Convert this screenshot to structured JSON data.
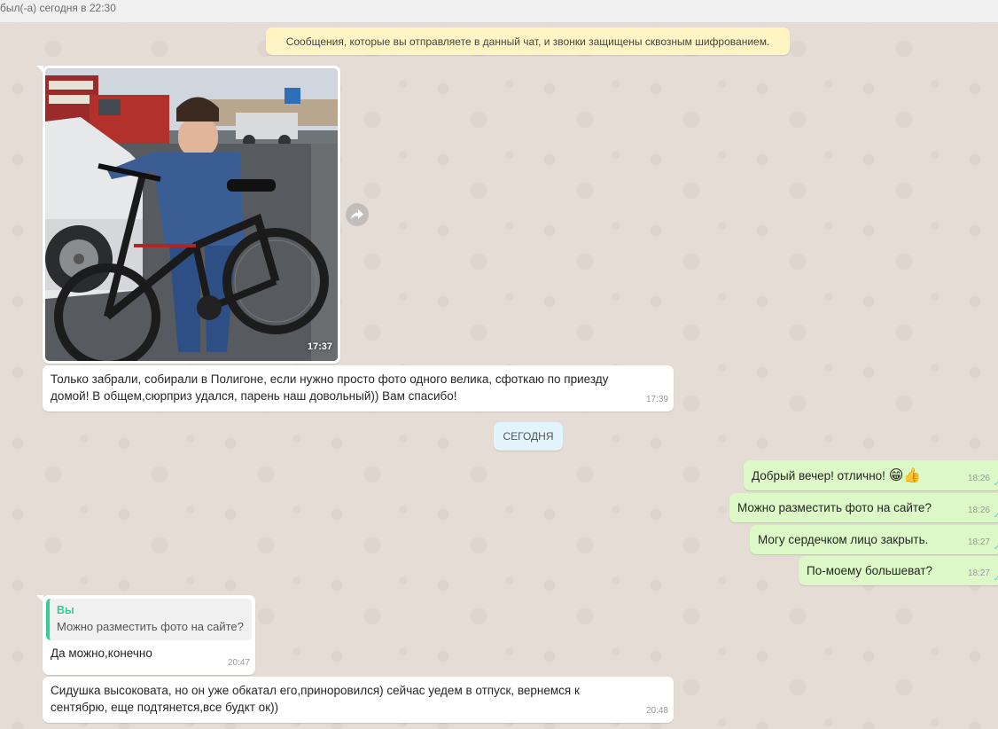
{
  "header": {
    "status": "был(-а) сегодня в 22:30"
  },
  "encryption_notice": "Сообщения, которые вы отправляете в данный чат, и звонки защищены сквозным шифрованием.",
  "messages": {
    "photo": {
      "time": "17:37"
    },
    "m1": {
      "text": "Только забрали, собирали в Полигоне, если нужно просто фото одного велика, сфоткаю по приезду домой! В общем,сюрприз удался, парень наш довольный)) Вам спасибо!",
      "time": "17:39"
    },
    "date_divider": "СЕГОДНЯ",
    "o1": {
      "text": "Добрый вечер! отлично!",
      "emoji": "😁👍",
      "time": "18:26"
    },
    "o2": {
      "text": "Можно разместить фото на сайте?",
      "time": "18:26"
    },
    "o3": {
      "text": "Могу сердечком лицо закрыть.",
      "time": "18:27"
    },
    "o4": {
      "text": "По-моему большеват?",
      "time": "18:27"
    },
    "m2": {
      "quote_author": "Вы",
      "quote_text": "Можно разместить фото на сайте?",
      "text": "Да можно,конечно",
      "time": "20:47"
    },
    "m3": {
      "text": "Сидушка высоковата, но он уже обкатал его,приноровился) сейчас уедем в отпуск, вернемся к сентябрю, еще подтянется,все будкт ок))",
      "time": "20:48"
    }
  },
  "colors": {
    "chat_background": "#e5ddd5",
    "incoming_bubble": "#ffffff",
    "outgoing_bubble": "#dcf8c6",
    "encryption_notice": "#fff5c4",
    "date_pill": "#e1f3fb",
    "quote_accent": "#35cd96",
    "read_ticks": "#4fc3f7"
  },
  "icons": {
    "forward": "forward-icon",
    "read_receipt": "double-check-icon"
  }
}
